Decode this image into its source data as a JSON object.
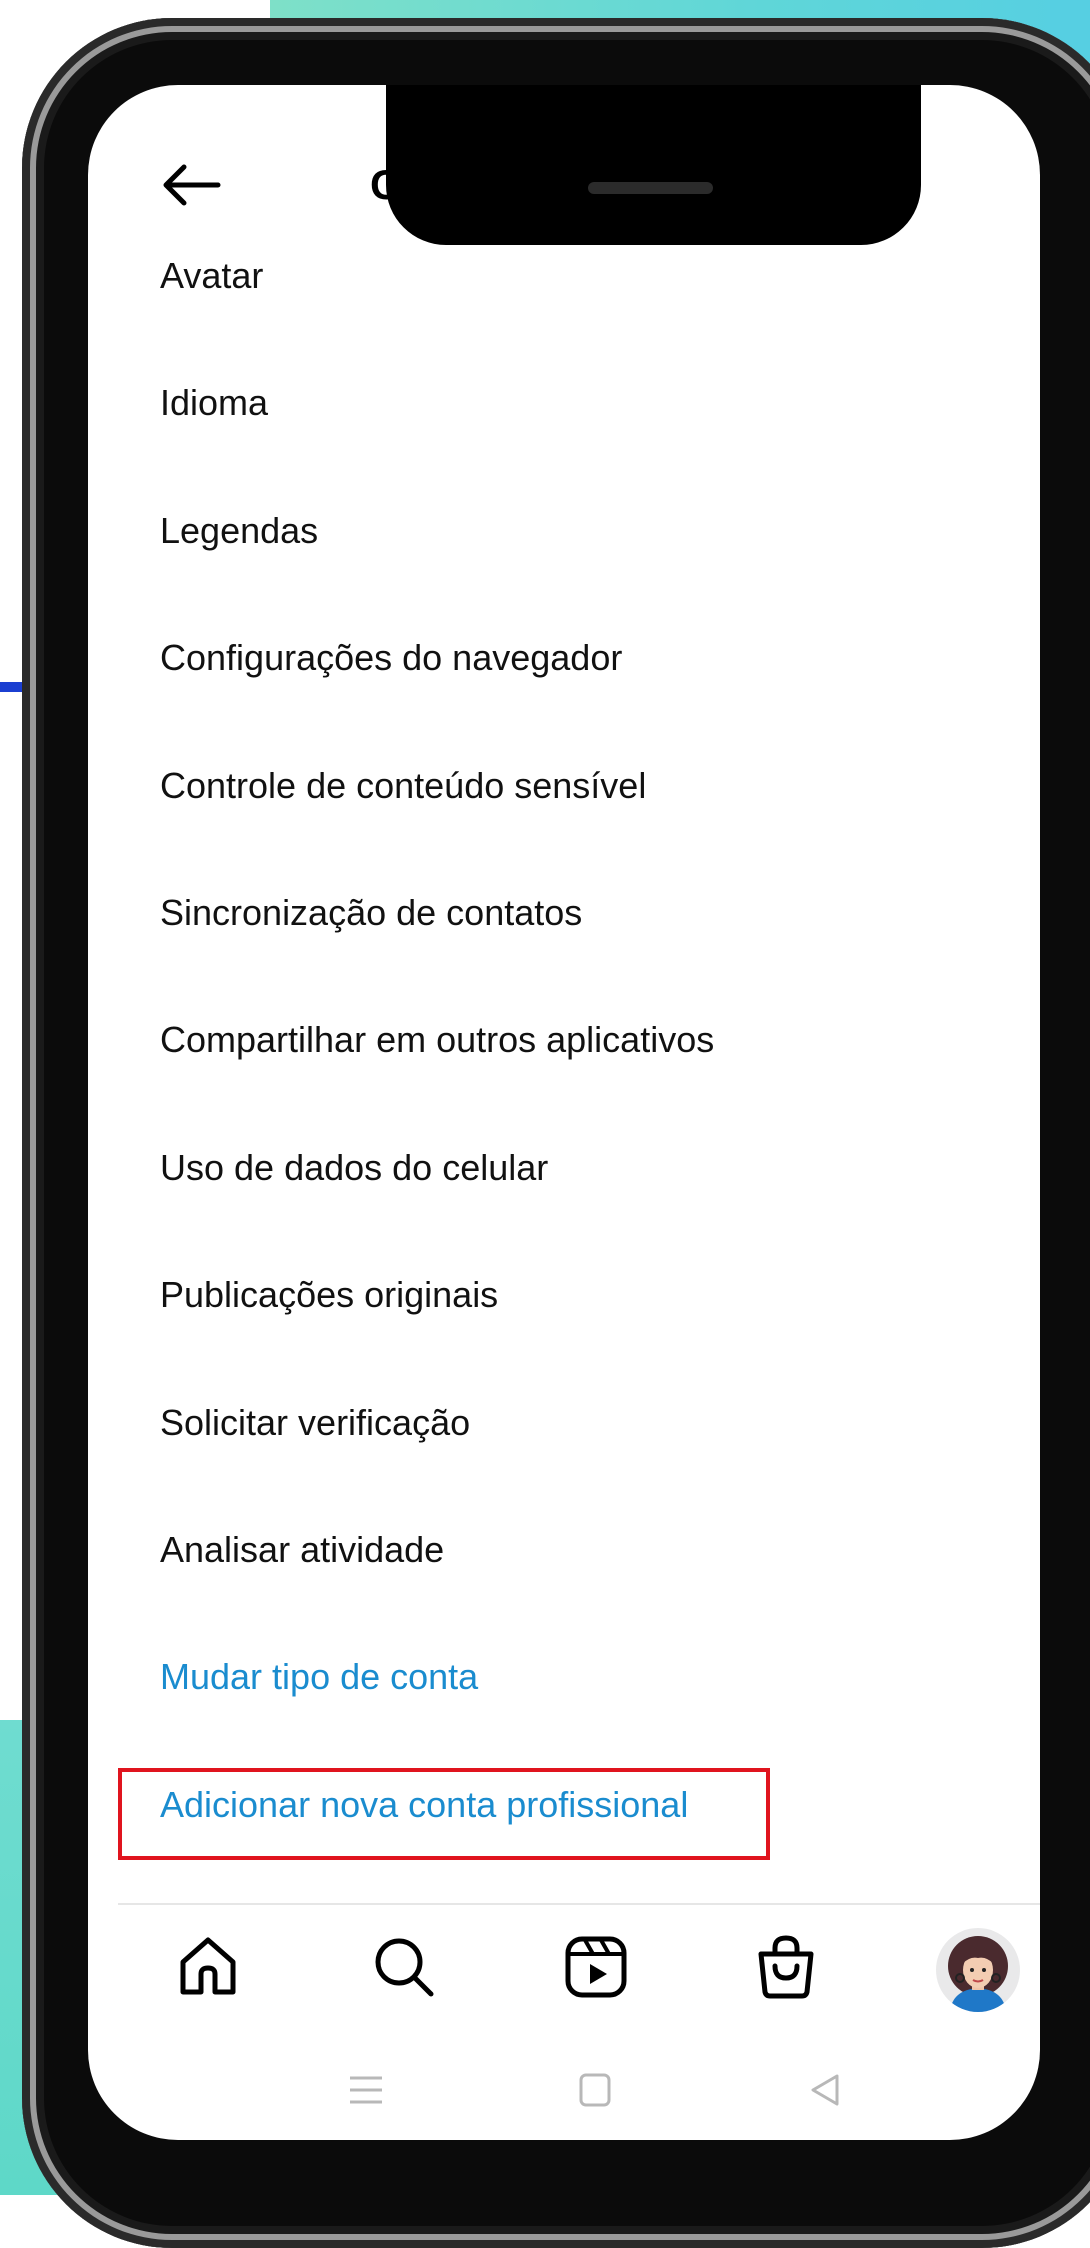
{
  "header": {
    "title": "Conta",
    "back_icon": "arrow-left-icon"
  },
  "menu": {
    "items": [
      {
        "label": "Avatar",
        "style": "normal"
      },
      {
        "label": "Idioma",
        "style": "normal"
      },
      {
        "label": "Legendas",
        "style": "normal"
      },
      {
        "label": "Configurações do navegador",
        "style": "normal"
      },
      {
        "label": "Controle de conteúdo sensível",
        "style": "normal"
      },
      {
        "label": "Sincronização de contatos",
        "style": "normal"
      },
      {
        "label": "Compartilhar em outros aplicativos",
        "style": "normal"
      },
      {
        "label": "Uso de dados do celular",
        "style": "normal"
      },
      {
        "label": "Publicações originais",
        "style": "normal"
      },
      {
        "label": "Solicitar verificação",
        "style": "normal"
      },
      {
        "label": "Analisar atividade",
        "style": "normal"
      },
      {
        "label": "Mudar tipo de conta",
        "style": "link"
      },
      {
        "label": "Adicionar nova conta profissional",
        "style": "link"
      }
    ]
  },
  "bottom_nav": {
    "items": [
      {
        "icon": "home-icon"
      },
      {
        "icon": "search-icon"
      },
      {
        "icon": "reels-icon"
      },
      {
        "icon": "shop-bag-icon"
      },
      {
        "icon": "profile-avatar"
      }
    ]
  },
  "system_nav": {
    "items": [
      {
        "icon": "menu-lines-icon"
      },
      {
        "icon": "home-square-icon"
      },
      {
        "icon": "back-triangle-icon"
      }
    ]
  },
  "colors": {
    "link": "#1a8ccf",
    "highlight": "#e0141e",
    "text": "#111111"
  }
}
